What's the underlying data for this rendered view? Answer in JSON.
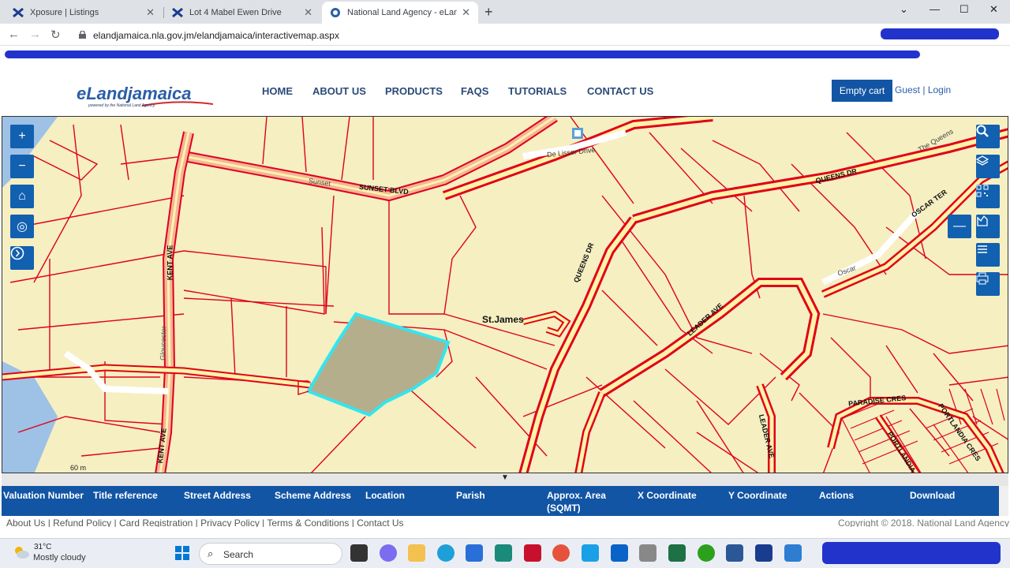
{
  "browser": {
    "tabs": [
      {
        "title": "Xposure | Listings",
        "active": false
      },
      {
        "title": "Lot 4 Mabel Ewen Drive",
        "active": false
      },
      {
        "title": "National Land Agency - eLandjan",
        "active": true
      }
    ],
    "new_tab": "+",
    "url": "elandjamaica.nla.gov.jm/elandjamaica/interactivemap.aspx",
    "window_controls": {
      "minimize": "—",
      "maximize": "☐",
      "close": "✕",
      "dropdown": "⌄"
    }
  },
  "site": {
    "logo": "eLandjamaica",
    "logo_tagline": "powered by the National Land Agency",
    "nav": [
      "HOME",
      "ABOUT US",
      "PRODUCTS",
      "FAQS",
      "TUTORIALS",
      "CONTACT US"
    ],
    "cart_button": "Empty cart",
    "guest": "Guest",
    "separator": "|",
    "login": "Login"
  },
  "map": {
    "left_tools": [
      {
        "name": "zoom-in",
        "icon": "+"
      },
      {
        "name": "zoom-out",
        "icon": "−"
      },
      {
        "name": "home",
        "icon": "⌂"
      },
      {
        "name": "locate",
        "icon": "◎"
      },
      {
        "name": "next",
        "icon": "›"
      }
    ],
    "right_tools": [
      {
        "name": "search",
        "icon": "search-icon"
      },
      {
        "name": "layers",
        "icon": "layers-icon"
      },
      {
        "name": "qr",
        "icon": "qr-icon"
      },
      {
        "name": "measure",
        "icon": "measure-icon"
      },
      {
        "name": "list",
        "icon": "list-icon"
      },
      {
        "name": "print",
        "icon": "print-icon"
      }
    ],
    "collapse_button": "—",
    "labels": {
      "sunset_script": "Sunset",
      "sunset_blvd": "SUNSET BLVD",
      "de_lisser": "De Lisser Drive",
      "queens_dr": "QUEENS DR",
      "queens_dr_vertical": "QUEENS DR",
      "the_queens": "The Queens",
      "oscar_ter": "OSCAR TER",
      "oscar": "Oscar",
      "leader_ave": "LEADER AVE",
      "leader_ave_vertical": "LEADER AVE",
      "kent_ave_top": "KENT AVE",
      "kent_ave_bottom": "KENT AVE",
      "gloucester": "Gloucester",
      "st_james": "St.James",
      "paradise": "PARADISE CRES",
      "portlandia_cres": "PORTLANDIA CRES",
      "portlandia": "PORTLANDIA"
    },
    "scale": "60 m",
    "colors": {
      "land": "#f5efc2",
      "parcel_line": "#e0001a",
      "road_fill": "#fff3a8",
      "selected_fill": "#b5ae8c",
      "selected_stroke": "#33e5ef",
      "water": "#9ec1e6"
    }
  },
  "grid": {
    "toggle": "▼",
    "columns": [
      "Valuation Number",
      "Title reference",
      "Street Address",
      "Scheme Address",
      "Location",
      "Parish",
      "Approx. Area (SQMT)",
      "X Coordinate",
      "Y Coordinate",
      "Actions",
      "Download"
    ]
  },
  "footer": {
    "links": "About Us | Refund Policy | Card Registration | Privacy Policy | Terms & Conditions | Contact Us",
    "copyright": "Copyright © 2018. National Land Agency"
  },
  "taskbar": {
    "temperature": "31°C",
    "weather": "Mostly cloudy",
    "search": "Search"
  }
}
